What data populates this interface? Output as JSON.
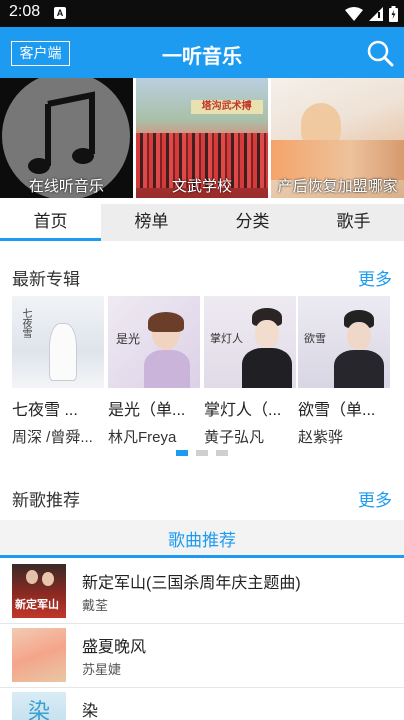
{
  "status_bar": {
    "time": "2:08",
    "notification_glyph": "A"
  },
  "app_bar": {
    "client_button": "客户端",
    "title": "一听音乐",
    "search_icon": "search-icon"
  },
  "banners": [
    {
      "caption": "在线听音乐",
      "icon": "music-note-icon"
    },
    {
      "caption": "文武学校",
      "sign_text": "塔沟武术搏"
    },
    {
      "caption": "产后恢复加盟哪家"
    }
  ],
  "tabs": [
    "首页",
    "榜单",
    "分类",
    "歌手"
  ],
  "active_tab": 0,
  "latest_albums": {
    "title": "最新专辑",
    "more": "更多",
    "items": [
      {
        "name": "七夜雪 ...",
        "artist": "周深 /曾舜...",
        "cover_text": "七夜雪"
      },
      {
        "name": "是光（单...",
        "artist": "林凡Freya",
        "cover_text": "是光"
      },
      {
        "name": "掌灯人（...",
        "artist": "黄子弘凡",
        "cover_text": "掌灯人"
      },
      {
        "name": "欲雪（单...",
        "artist": "赵紫骅",
        "cover_text": "欲雪"
      }
    ],
    "pager": {
      "count": 3,
      "active": 0
    }
  },
  "new_songs": {
    "title": "新歌推荐",
    "more": "更多",
    "tab_label": "歌曲推荐",
    "items": [
      {
        "title": "新定军山(三国杀周年庆主题曲)",
        "artist": "戴荃",
        "cover_text": "新定军山"
      },
      {
        "title": "盛夏晚风",
        "artist": "苏星婕"
      },
      {
        "title": "染",
        "artist": "",
        "cover_text": "染"
      }
    ]
  },
  "colors": {
    "accent": "#1d9bf0",
    "status_bar": "#0d0d0d",
    "tab_bg": "#ededed"
  }
}
